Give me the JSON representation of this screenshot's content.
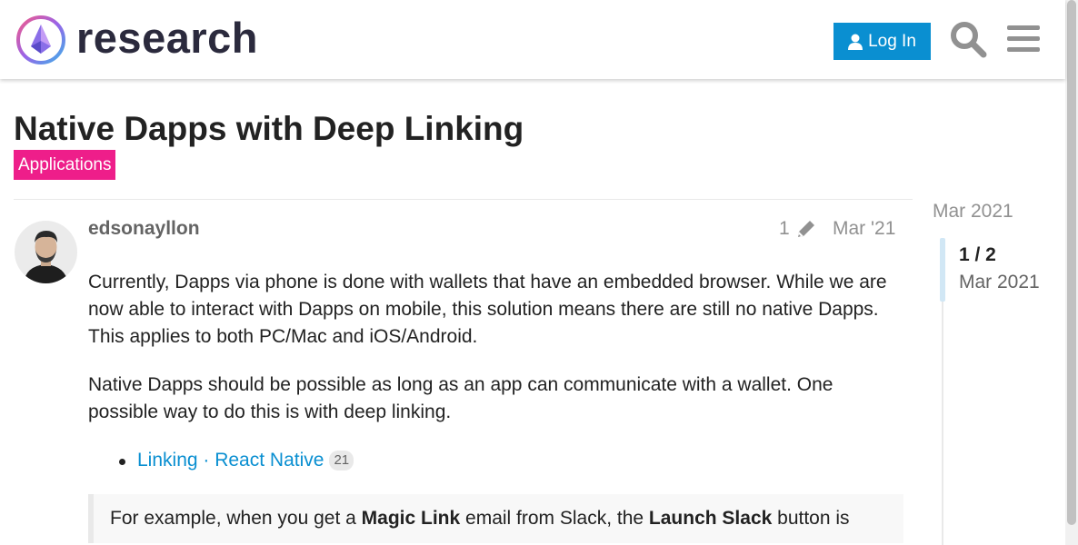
{
  "header": {
    "logo_text": "research",
    "login_label": "Log In"
  },
  "topic": {
    "title": "Native Dapps with Deep Linking",
    "category": "Applications",
    "category_color": "#ee1e8a"
  },
  "post": {
    "username": "edsonayllon",
    "edit_count": "1",
    "date": "Mar '21",
    "paragraphs": [
      "Currently, Dapps via phone is done with wallets that have an embedded browser. While we are now able to interact with Dapps on mobile, this solution means there are still no native Dapps. This applies to both PC/Mac and iOS/Android.",
      "Native Dapps should be possible as long as an app can communicate with a wallet. One possible way to do this is with deep linking."
    ],
    "link": {
      "text": "Linking · React Native",
      "clicks": "21"
    },
    "quote": {
      "t1": "For example, when you get a ",
      "b1": "Magic Link",
      "t2": " email from Slack, the ",
      "b2": "Launch Slack",
      "t3": " button is"
    }
  },
  "timeline": {
    "top_date": "Mar 2021",
    "position": "1 / 2",
    "current_date": "Mar 2021"
  },
  "colors": {
    "accent": "#0a8fd1",
    "category": "#ee1e8a"
  },
  "icons": [
    "user-icon",
    "search-icon",
    "hamburger-menu-icon",
    "pencil-icon"
  ]
}
